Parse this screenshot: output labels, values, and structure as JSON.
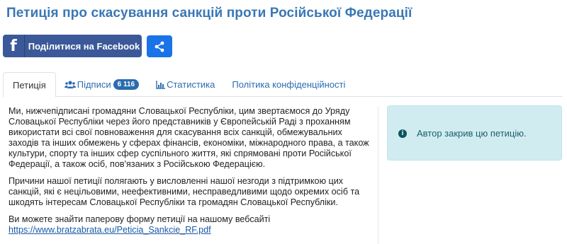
{
  "page": {
    "title": "Петиція про скасування санкцій проти Російської Федерації"
  },
  "share": {
    "facebook_label": "Поділитися на Facebook",
    "facebook_icon": "f",
    "brand_color": "#3b5998",
    "share_color": "#1a73e8"
  },
  "tabs": [
    {
      "label": "Петиція",
      "active": true
    },
    {
      "label": "Підписи",
      "badge": "6 116",
      "icon": "users-icon"
    },
    {
      "label": "Статистика",
      "icon": "bar-chart-icon"
    },
    {
      "label": "Політика конфіденційності"
    }
  ],
  "petition": {
    "paragraph1": "Ми, нижчепідписані громадяни Словацької Республіки, цим звертаємося до Уряду Словацької Республіки через його представників у Європейській Раді з проханням використати всі свої повноваження для скасування всіх санкцій, обмежувальних заходів та інших обмежень у сферах фінансів, економіки, міжнародного права, а також культури, спорту та інших сфер суспільного життя, які спрямовані проти Російської Федерації, а також осіб, пов'язаних з Російською Федерацією.",
    "paragraph2": "Причини нашої петиції полягають у висловленні нашої незгоди з підтримкою цих санкцій, які є нецільовими, неефективними, несправедливими щодо окремих осіб та шкодять інтересам Словацької Республіки та громадян Словацької Республіки.",
    "paragraph3": "Ви можете знайти паперову форму петиції на нашому вебсайті",
    "link": "https://www.bratzabrata.eu/Peticia_Sankcie_RF.pdf"
  },
  "alert": {
    "text": "Автор закрив цю петицію.",
    "icon": "info-icon",
    "color": "#d1ecf1"
  }
}
